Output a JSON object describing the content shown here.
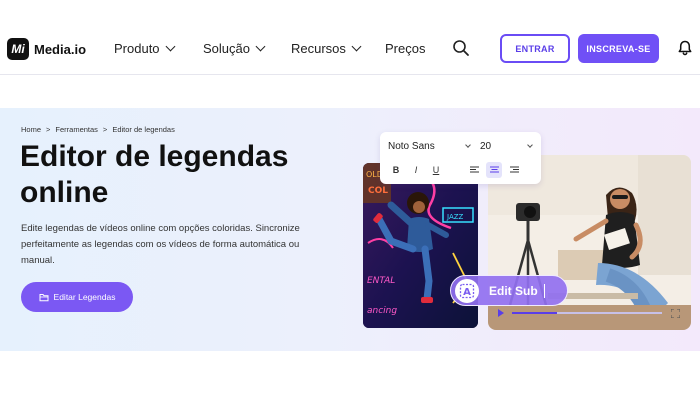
{
  "header": {
    "logo_mark": "Mi",
    "logo_text": "Media.io",
    "nav": [
      {
        "label": "Produto"
      },
      {
        "label": "Solução"
      },
      {
        "label": "Recursos"
      },
      {
        "label": "Preços"
      }
    ],
    "login_label": "ENTRAR",
    "signup_label": "INSCREVA-SE"
  },
  "hero": {
    "breadcrumb": [
      "Home",
      ">",
      "Ferramentas",
      ">",
      "Editor de legendas"
    ],
    "title": "Editor de legendas online",
    "description": "Edite legendas de vídeos online com opções coloridas. Sincronize perfeitamente as legendas com os vídeos de forma automática ou manual.",
    "cta_label": "Editar Legendas"
  },
  "editor_toolbar": {
    "font": "Noto Sans",
    "size": "20",
    "bold": "B",
    "italic": "I",
    "underline": "U"
  },
  "edit_sub_label": "Edit Sub",
  "player": {
    "progress": 0.3
  },
  "colors": {
    "accent": "#7050f6",
    "accent_border": "#6a4cf5",
    "hero_bg_left": "#e6f1fd",
    "hero_bg_right": "#f3e9fb"
  },
  "icons": [
    "search-icon",
    "bell-icon",
    "folder-icon",
    "text-a-icon",
    "play-icon",
    "fullscreen-icon",
    "align-left-icon",
    "align-center-icon",
    "align-right-icon"
  ]
}
